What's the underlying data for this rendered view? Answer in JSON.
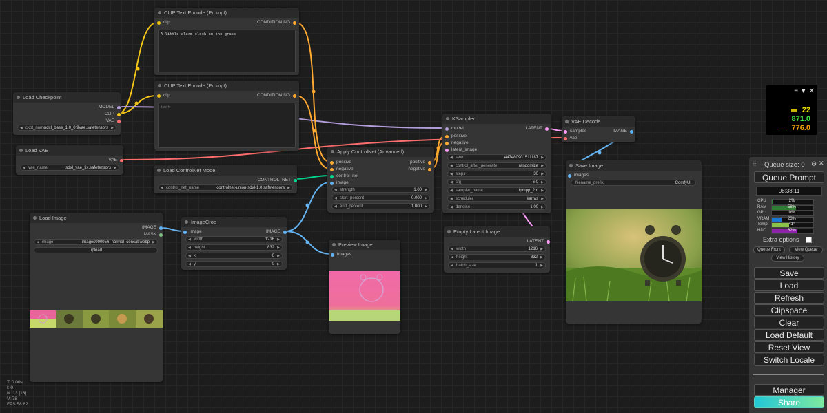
{
  "nodes": {
    "load_checkpoint": {
      "title": "Load Checkpoint",
      "outputs": [
        "MODEL",
        "CLIP",
        "VAE"
      ],
      "widget": {
        "name": "ckpt_name",
        "value": "sdxl_base_1.0_0.9vae.safetensors"
      }
    },
    "load_vae": {
      "title": "Load VAE",
      "outputs": [
        "VAE"
      ],
      "widget": {
        "name": "vae_name",
        "value": "sdxl_vae_fix.safetensors"
      }
    },
    "clip_pos": {
      "title": "CLIP Text Encode (Prompt)",
      "input": "clip",
      "output": "CONDITIONING",
      "text": "A little alarm clock on the grass"
    },
    "clip_neg": {
      "title": "CLIP Text Encode (Prompt)",
      "input": "clip",
      "output": "CONDITIONING",
      "placeholder": "text"
    },
    "controlnet_loader": {
      "title": "Load ControlNet Model",
      "output": "CONTROL_NET",
      "widget": {
        "name": "control_net_name",
        "value": "controlnet-union-sdxl-1.0.safetensors"
      }
    },
    "apply_controlnet": {
      "title": "Apply ControlNet (Advanced)",
      "inputs": [
        "positive",
        "negative",
        "control_net",
        "image"
      ],
      "outputs": [
        "positive",
        "negative"
      ],
      "widgets": [
        {
          "name": "strength",
          "value": "1.00"
        },
        {
          "name": "start_percent",
          "value": "0.000"
        },
        {
          "name": "end_percent",
          "value": "1.000"
        }
      ]
    },
    "ksampler": {
      "title": "KSampler",
      "inputs": [
        "model",
        "positive",
        "negative",
        "latent_image"
      ],
      "output": "LATENT",
      "widgets": [
        {
          "name": "seed",
          "value": "447480901511187"
        },
        {
          "name": "control_after_generate",
          "value": "randomize"
        },
        {
          "name": "steps",
          "value": "30"
        },
        {
          "name": "cfg",
          "value": "6.0"
        },
        {
          "name": "sampler_name",
          "value": "dpmpp_2m"
        },
        {
          "name": "scheduler",
          "value": "karras"
        },
        {
          "name": "denoise",
          "value": "1.00"
        }
      ]
    },
    "vae_decode": {
      "title": "VAE Decode",
      "inputs": [
        "samples",
        "vae"
      ],
      "output": "IMAGE"
    },
    "save_image": {
      "title": "Save Image",
      "input": "images",
      "widget": {
        "name": "filename_prefix",
        "value": "ComfyUI"
      }
    },
    "empty_latent": {
      "title": "Empty Latent Image",
      "output": "LATENT",
      "widgets": [
        {
          "name": "width",
          "value": "1216"
        },
        {
          "name": "height",
          "value": "832"
        },
        {
          "name": "batch_size",
          "value": "1"
        }
      ]
    },
    "load_image": {
      "title": "Load Image",
      "outputs": [
        "IMAGE",
        "MASK"
      ],
      "widget": {
        "name": "image",
        "value": "images000056_normal_concat.webp"
      },
      "upload_label": "upload"
    },
    "image_crop": {
      "title": "ImageCrop",
      "input": "image",
      "output": "IMAGE",
      "widgets": [
        {
          "name": "width",
          "value": "1216"
        },
        {
          "name": "height",
          "value": "832"
        },
        {
          "name": "x",
          "value": "0"
        },
        {
          "name": "y",
          "value": "0"
        }
      ]
    },
    "preview_image": {
      "title": "Preview Image",
      "input": "images"
    }
  },
  "colors": {
    "clip": "#f5c518",
    "model": "#b39ddb",
    "vae": "#ff6e6e",
    "conditioning": "#ffa931",
    "control_net": "#00d78d",
    "image": "#64b5f6",
    "latent": "#ff9cf9",
    "mask": "#81c784"
  },
  "monitor": {
    "v1": "22",
    "v2": "871.0",
    "v3": "776.0"
  },
  "panel": {
    "queue_size": "Queue size: 0",
    "queue_prompt": "Queue Prompt",
    "time": "08:38:11",
    "stats": [
      {
        "label": "CPU",
        "pct": 2,
        "text": "2%",
        "color": "#2e7d32"
      },
      {
        "label": "RAM",
        "pct": 58,
        "text": "58%",
        "color": "#2e7d32"
      },
      {
        "label": "GPU",
        "pct": 0,
        "text": "0%",
        "color": "#2e7d32"
      },
      {
        "label": "VRAM",
        "pct": 23,
        "text": "23%",
        "color": "#1976d2"
      },
      {
        "label": "Temp",
        "pct": 41,
        "text": "41°",
        "color": "#8bc34a"
      },
      {
        "label": "HDD",
        "pct": 62,
        "text": "62%",
        "color": "#8e24aa"
      }
    ],
    "extra_options": "Extra options",
    "queue_front": "Queue Front",
    "view_queue": "View Queue",
    "view_history": "View History",
    "buttons": [
      "Save",
      "Load",
      "Refresh",
      "Clipspace",
      "Clear",
      "Load Default",
      "Reset View",
      "Switch Locale"
    ],
    "manager": "Manager",
    "share": "Share"
  },
  "debug": {
    "t": "T: 0.00s",
    "i": "I: 0",
    "n": "N: 13 [13]",
    "v": "V: 78",
    "fps": "FPS:58.82"
  }
}
